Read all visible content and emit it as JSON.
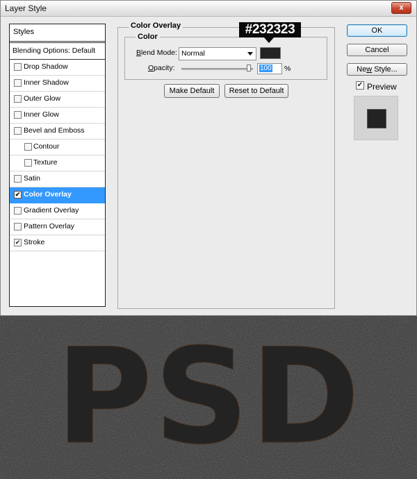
{
  "window": {
    "title": "Layer Style",
    "close_label": "x"
  },
  "styles_panel": {
    "header": "Styles",
    "blending_options": "Blending Options: Default",
    "items": [
      {
        "label": "Drop Shadow",
        "checked": false,
        "indent": 0
      },
      {
        "label": "Inner Shadow",
        "checked": false,
        "indent": 0
      },
      {
        "label": "Outer Glow",
        "checked": false,
        "indent": 0
      },
      {
        "label": "Inner Glow",
        "checked": false,
        "indent": 0
      },
      {
        "label": "Bevel and Emboss",
        "checked": false,
        "indent": 0
      },
      {
        "label": "Contour",
        "checked": false,
        "indent": 1
      },
      {
        "label": "Texture",
        "checked": false,
        "indent": 1
      },
      {
        "label": "Satin",
        "checked": false,
        "indent": 0
      },
      {
        "label": "Color Overlay",
        "checked": true,
        "indent": 0,
        "selected": true
      },
      {
        "label": "Gradient Overlay",
        "checked": false,
        "indent": 0
      },
      {
        "label": "Pattern Overlay",
        "checked": false,
        "indent": 0
      },
      {
        "label": "Stroke",
        "checked": true,
        "indent": 0
      }
    ]
  },
  "color_overlay": {
    "section_title": "Color Overlay",
    "group_title": "Color",
    "blend_mode_label": "Blend Mode:",
    "blend_mode_value": "Normal",
    "opacity_label": "Opacity:",
    "opacity_value": "100",
    "opacity_unit": "%",
    "opacity_level": 1.0,
    "color_hex_callout": "#232323",
    "swatch_color": "#232323",
    "make_default_label": "Make Default",
    "reset_default_label": "Reset to Default"
  },
  "side_buttons": {
    "ok": "OK",
    "cancel": "Cancel",
    "new_style": "New Style...",
    "preview_label": "Preview",
    "preview_checked": true
  },
  "canvas": {
    "text": "PSD",
    "text_color": "#232323",
    "background_color": "#2e2e2e"
  },
  "colors": {
    "selection": "#3399ff",
    "dialog_bg": "#ebebeb"
  }
}
